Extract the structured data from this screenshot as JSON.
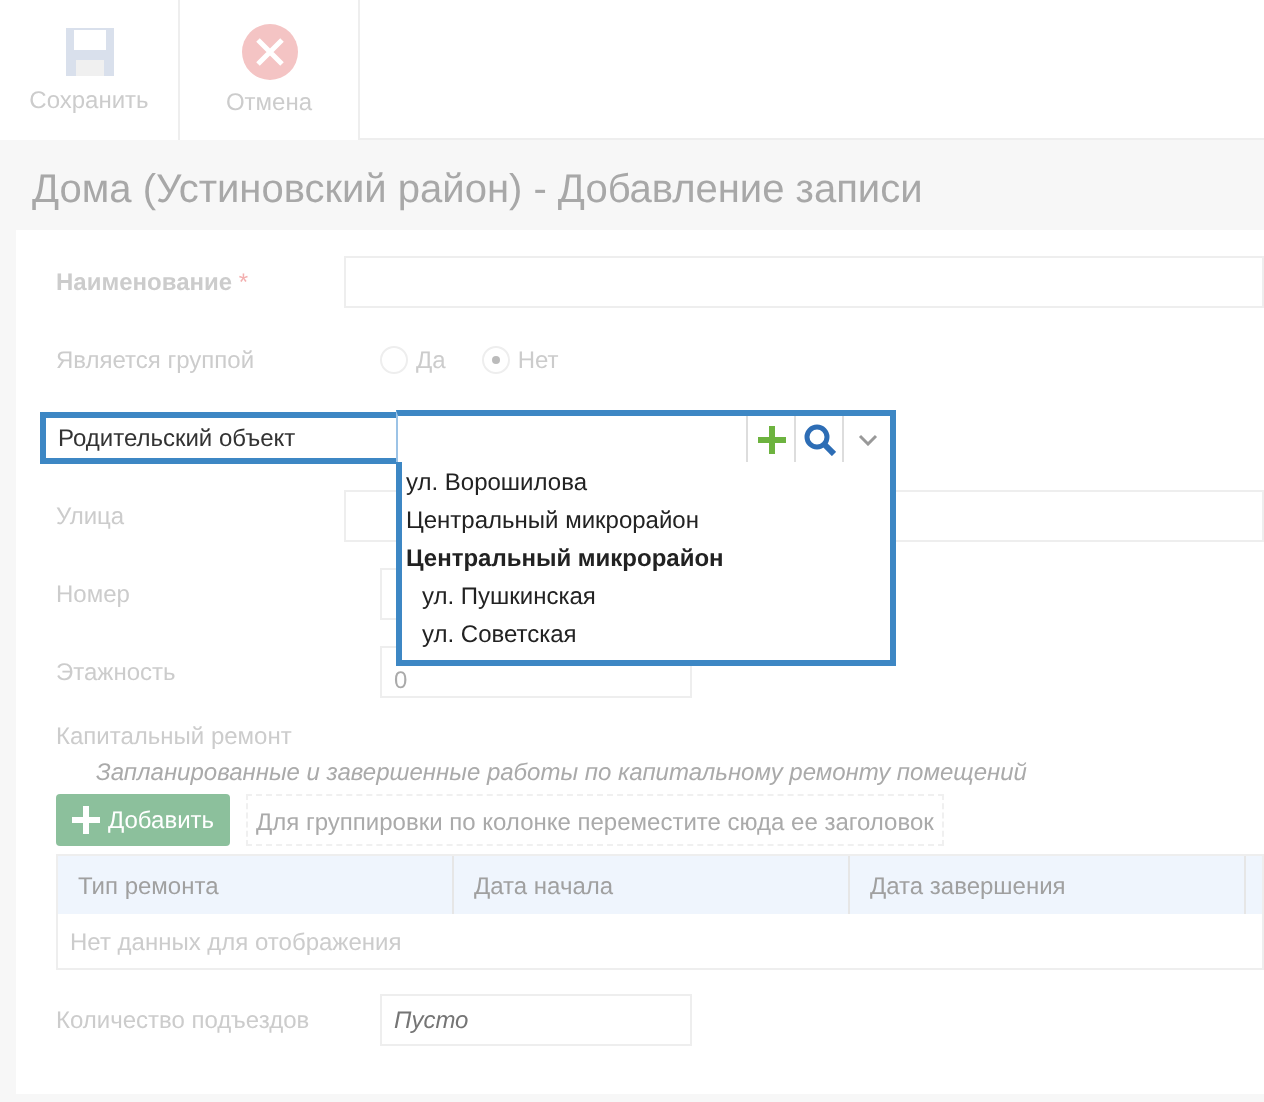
{
  "toolbar": {
    "buttons": [
      {
        "kind": "save",
        "label": "Сохранить"
      },
      {
        "kind": "cancel",
        "label": "Отмена"
      }
    ]
  },
  "title": "Дома (Устиновский район) - Добавление записи",
  "form": {
    "name": {
      "label": "Наименование",
      "required": "*"
    },
    "is_group": {
      "label": "Является группой",
      "options": [
        {
          "label": "Да",
          "selected": false
        },
        {
          "label": "Нет",
          "selected": true
        }
      ]
    },
    "parent": {
      "label": "Родительский объект",
      "dropdown": [
        {
          "kind": "item",
          "label": "ул. Ворошилова"
        },
        {
          "kind": "item",
          "label": "Центральный микрорайон"
        },
        {
          "kind": "group",
          "label": "Центральный микрорайон",
          "children": [
            {
              "kind": "item",
              "label": "ул. Пушкинская"
            },
            {
              "kind": "item",
              "label": "ул. Советская"
            }
          ]
        }
      ]
    },
    "street": {
      "label": "Улица"
    },
    "number": {
      "label": "Номер"
    },
    "floors": {
      "label": "Этажность",
      "value": "0"
    },
    "repair": {
      "label": "Капитальный ремонт",
      "hint": "Запланированные и завершенные работы по капитальному ремонту помещений",
      "add_button": "Добавить",
      "group_panel": "Для группировки по колонке переместите сюда ее заголовок",
      "columns": [
        "Тип ремонта",
        "Дата начала",
        "Дата завершения"
      ],
      "empty": "Нет данных для отображения"
    },
    "entrances": {
      "label": "Количество подъездов",
      "placeholder": "Пусто"
    }
  }
}
